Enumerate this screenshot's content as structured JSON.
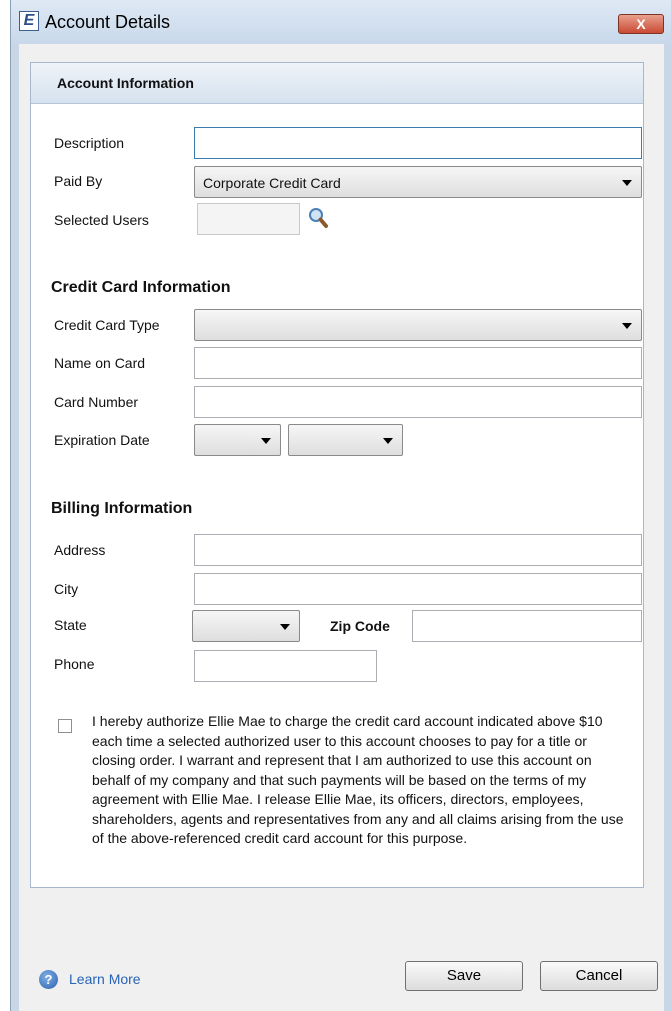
{
  "window": {
    "title": "Account Details",
    "app_icon_letter": "E",
    "close_glyph": "X"
  },
  "panel": {
    "title": "Account Information"
  },
  "fields": {
    "description": {
      "label": "Description",
      "value": ""
    },
    "paid_by": {
      "label": "Paid By",
      "value": "Corporate Credit Card"
    },
    "selected_users": {
      "label": "Selected Users",
      "value": ""
    }
  },
  "credit_card": {
    "heading": "Credit Card Information",
    "type": {
      "label": "Credit Card Type",
      "value": ""
    },
    "name": {
      "label": "Name on Card",
      "value": ""
    },
    "number": {
      "label": "Card Number",
      "value": ""
    },
    "expiration": {
      "label": "Expiration Date",
      "month": "",
      "year": ""
    }
  },
  "billing": {
    "heading": "Billing Information",
    "address": {
      "label": "Address",
      "value": ""
    },
    "city": {
      "label": "City",
      "value": ""
    },
    "state": {
      "label": "State",
      "value": ""
    },
    "zip": {
      "label": "Zip Code",
      "value": ""
    },
    "phone": {
      "label": "Phone",
      "value": ""
    }
  },
  "authorization": {
    "checked": false,
    "text": "I hereby authorize Ellie Mae to charge the credit card account indicated above $10 each time a selected authorized user to this account chooses to pay for a title or closing order.  I warrant and represent that I am authorized to use this account on behalf of my company and that such payments will be based on the terms of my agreement with Ellie Mae. I release Ellie Mae, its officers, directors, employees, shareholders, agents and representatives from any and all claims arising from the use of the above-referenced credit card account for this purpose."
  },
  "footer": {
    "help_glyph": "?",
    "learn_more": "Learn More",
    "save": "Save",
    "cancel": "Cancel"
  },
  "icons": {
    "app": "app-logo-icon",
    "close": "close-icon",
    "search": "search-icon",
    "help": "help-icon",
    "dropdown": "chevron-down-icon"
  },
  "colors": {
    "title_bar": "#c8d8ea",
    "close_button": "#c94a33",
    "link": "#2864b4",
    "panel_header": "#d6e2ef"
  }
}
